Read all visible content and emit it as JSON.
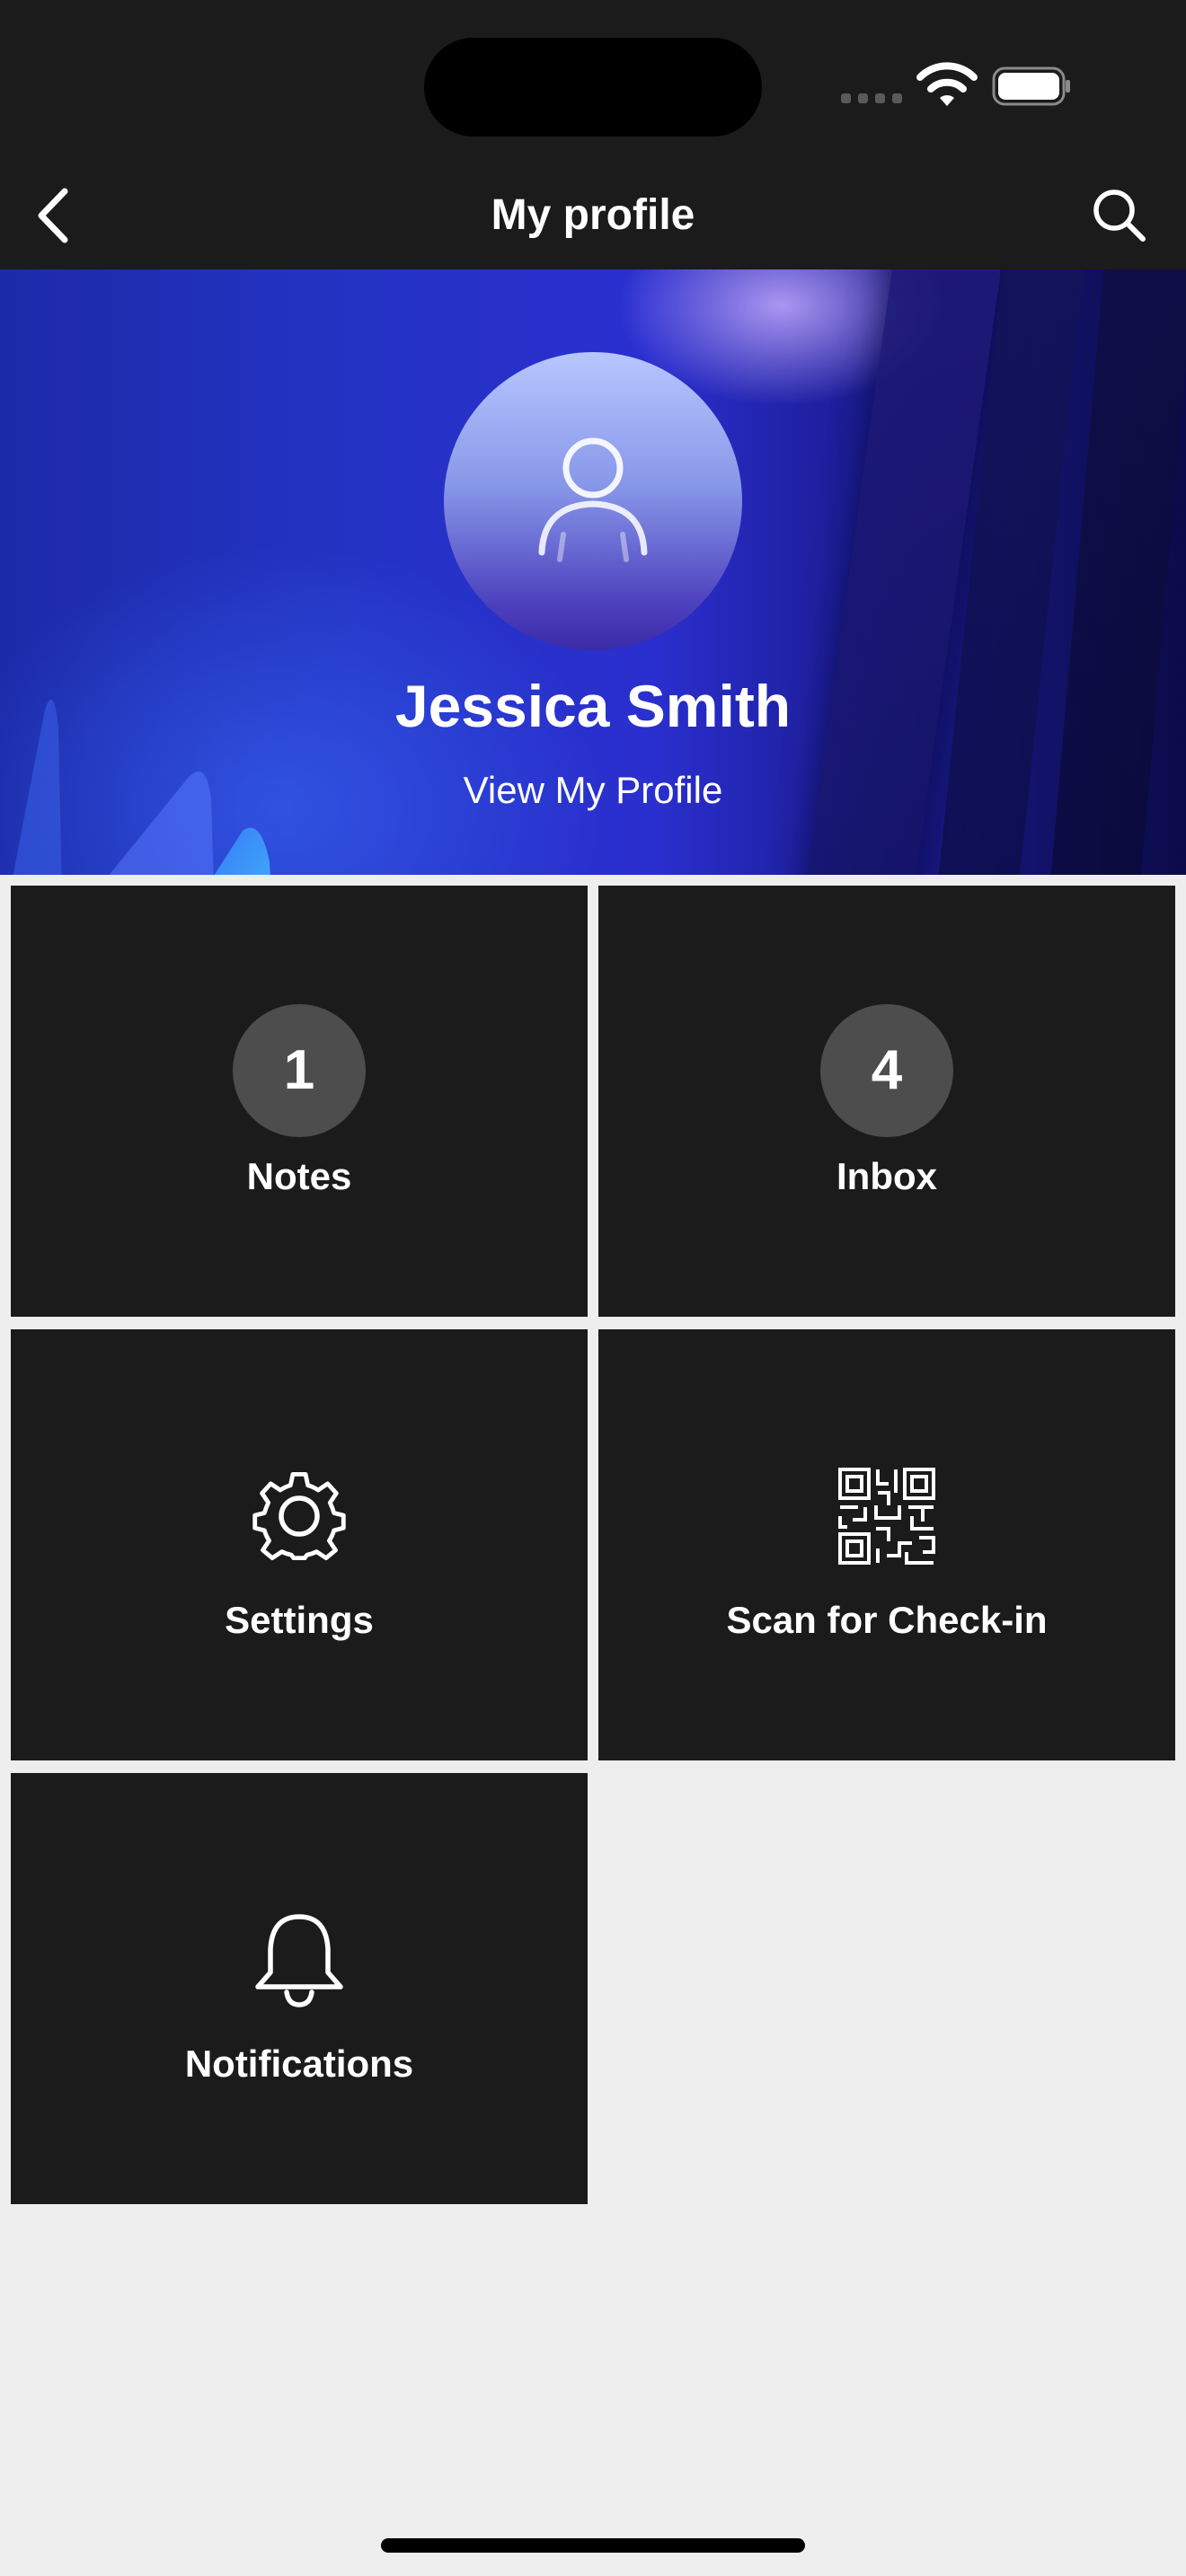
{
  "header": {
    "title": "My profile"
  },
  "profile": {
    "name": "Jessica Smith",
    "view_link": "View My Profile"
  },
  "tiles": [
    {
      "label": "Notes",
      "badge": "1",
      "icon": "count-badge"
    },
    {
      "label": "Inbox",
      "badge": "4",
      "icon": "count-badge"
    },
    {
      "label": "Settings",
      "icon": "gear-icon"
    },
    {
      "label": "Scan for Check-in",
      "icon": "qr-code-icon"
    },
    {
      "label": "Notifications",
      "icon": "bell-icon"
    }
  ],
  "colors": {
    "tile_background": "#1b1b1b",
    "badge_background": "#4d4d4d",
    "page_background": "#eeeeee",
    "hero_accent": "#2433c4"
  }
}
